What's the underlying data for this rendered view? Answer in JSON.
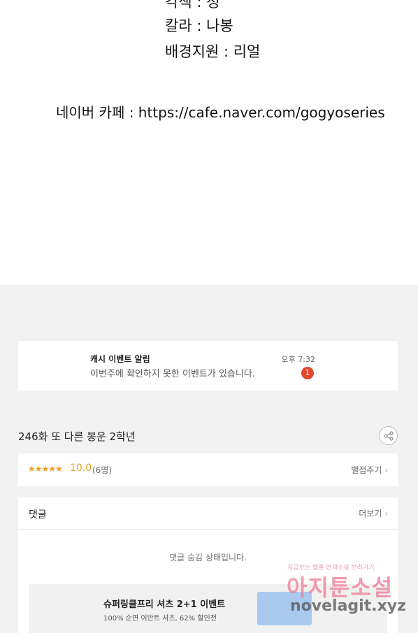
{
  "credits": {
    "partial_line": "각색 : 정",
    "color_line": "칼라 : 나봉",
    "background_line": "배경지원 : 리얼",
    "cafe_line": "네이버 카페 : https://cafe.naver.com/gogyoseries"
  },
  "notification": {
    "title": "캐시 이벤트 알림",
    "message": "이번주에 확인하지 못한 이벤트가 있습니다.",
    "time": "오후 7:32",
    "badge_count": "1"
  },
  "episode": {
    "title": "246화 또 다른 봉운 2학년"
  },
  "rating": {
    "stars": "★★★★★",
    "score": "10.0",
    "count": "(6명)",
    "rate_link": "별점주기"
  },
  "comments": {
    "title": "댓글",
    "more_link": "더보기",
    "hidden_message": "댓글 숨김 상태입니다."
  },
  "ad": {
    "title": "슈퍼링클프리 셔츠 2+1 이벤트",
    "subtitle": "100% 순면 이반트 셔츠, 62% 할인전"
  },
  "watermark": {
    "top_text": "지금보는 웹툰 연재소설 보러가기",
    "main_text": "아지툰소설",
    "url": "novelagit.xyz"
  },
  "colors": {
    "page_bg": "#f2f2f2",
    "accent_star": "#f0a020",
    "badge_red": "#e0472b"
  }
}
